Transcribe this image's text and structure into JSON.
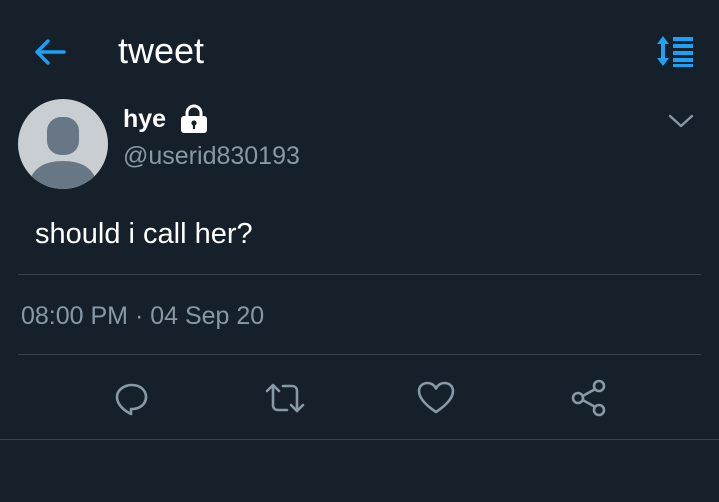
{
  "header": {
    "title": "tweet",
    "back_icon": "arrow-left-icon",
    "sort_icon": "sort-list-icon",
    "accent_color": "#1da1f2"
  },
  "tweet": {
    "display_name": "hye",
    "protected_icon": "lock-icon",
    "username": "@userid830193",
    "text": "should i call her?",
    "timestamp": "08:00 PM · 04 Sep 20"
  },
  "actions": [
    {
      "name": "reply",
      "icon": "reply-icon"
    },
    {
      "name": "retweet",
      "icon": "retweet-icon"
    },
    {
      "name": "like",
      "icon": "heart-icon"
    },
    {
      "name": "share",
      "icon": "share-icon"
    }
  ],
  "colors": {
    "background": "#15202b",
    "secondary_text": "#8899a6",
    "divider": "#38444d",
    "icon_gray": "#8899a6"
  }
}
